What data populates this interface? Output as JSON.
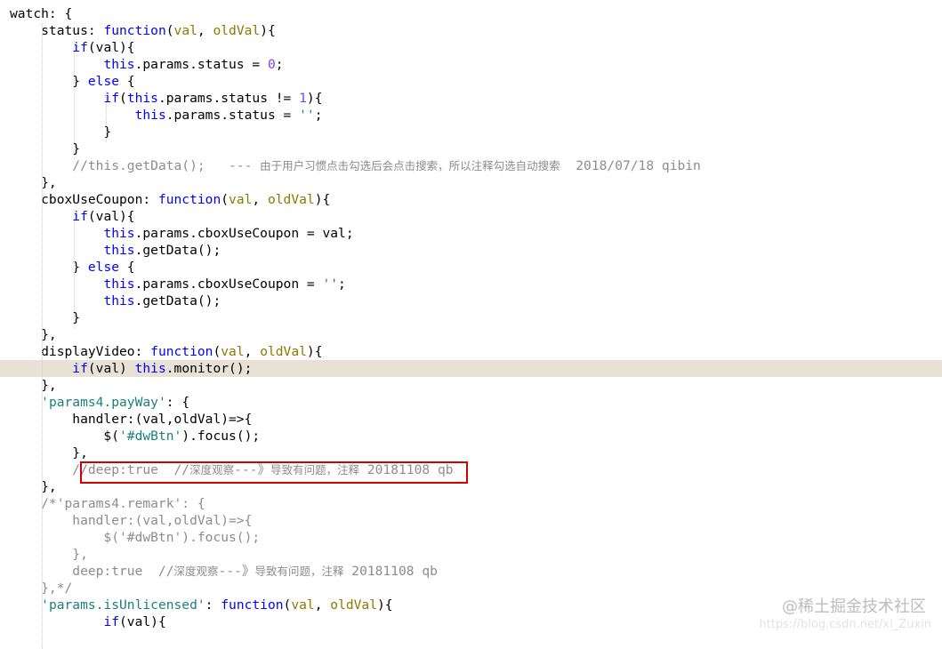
{
  "editor": {
    "lines": [
      {
        "tokens": [
          {
            "t": "watch: {",
            "c": ""
          }
        ]
      },
      {
        "tokens": [
          {
            "t": "    status: ",
            "c": ""
          },
          {
            "t": "function",
            "c": "k"
          },
          {
            "t": "(",
            "c": ""
          },
          {
            "t": "val",
            "c": "p"
          },
          {
            "t": ", ",
            "c": ""
          },
          {
            "t": "oldVal",
            "c": "p"
          },
          {
            "t": "){",
            "c": ""
          }
        ]
      },
      {
        "tokens": [
          {
            "t": "        ",
            "c": ""
          },
          {
            "t": "if",
            "c": "k"
          },
          {
            "t": "(val){",
            "c": ""
          }
        ]
      },
      {
        "tokens": [
          {
            "t": "            ",
            "c": ""
          },
          {
            "t": "this",
            "c": "k"
          },
          {
            "t": ".params.status = ",
            "c": ""
          },
          {
            "t": "0",
            "c": "n"
          },
          {
            "t": ";",
            "c": ""
          }
        ]
      },
      {
        "tokens": [
          {
            "t": "        } ",
            "c": ""
          },
          {
            "t": "else",
            "c": "k"
          },
          {
            "t": " {",
            "c": ""
          }
        ]
      },
      {
        "tokens": [
          {
            "t": "            ",
            "c": ""
          },
          {
            "t": "if",
            "c": "k"
          },
          {
            "t": "(",
            "c": ""
          },
          {
            "t": "this",
            "c": "k"
          },
          {
            "t": ".params.status != ",
            "c": ""
          },
          {
            "t": "1",
            "c": "n"
          },
          {
            "t": "){",
            "c": ""
          }
        ]
      },
      {
        "tokens": [
          {
            "t": "                ",
            "c": ""
          },
          {
            "t": "this",
            "c": "k"
          },
          {
            "t": ".params.status = ",
            "c": ""
          },
          {
            "t": "''",
            "c": "s"
          },
          {
            "t": ";",
            "c": ""
          }
        ]
      },
      {
        "tokens": [
          {
            "t": "            }",
            "c": ""
          }
        ]
      },
      {
        "tokens": [
          {
            "t": "        }",
            "c": ""
          }
        ]
      },
      {
        "tokens": [
          {
            "t": "        ",
            "c": ""
          },
          {
            "t": "//this.getData();   --- ",
            "c": "c"
          },
          {
            "t": "由于用户习惯点击勾选后会点击搜索，所以注释勾选自动搜索",
            "c": "cc"
          },
          {
            "t": "  2018/07/18 qibin",
            "c": "c"
          }
        ]
      },
      {
        "tokens": [
          {
            "t": "    },",
            "c": ""
          }
        ]
      },
      {
        "tokens": [
          {
            "t": "    cboxUseCoupon: ",
            "c": ""
          },
          {
            "t": "function",
            "c": "k"
          },
          {
            "t": "(",
            "c": ""
          },
          {
            "t": "val",
            "c": "p"
          },
          {
            "t": ", ",
            "c": ""
          },
          {
            "t": "oldVal",
            "c": "p"
          },
          {
            "t": "){",
            "c": ""
          }
        ]
      },
      {
        "tokens": [
          {
            "t": "        ",
            "c": ""
          },
          {
            "t": "if",
            "c": "k"
          },
          {
            "t": "(val){",
            "c": ""
          }
        ]
      },
      {
        "tokens": [
          {
            "t": "            ",
            "c": ""
          },
          {
            "t": "this",
            "c": "k"
          },
          {
            "t": ".params.cboxUseCoupon = val;",
            "c": ""
          }
        ]
      },
      {
        "tokens": [
          {
            "t": "            ",
            "c": ""
          },
          {
            "t": "this",
            "c": "k"
          },
          {
            "t": ".getData();",
            "c": ""
          }
        ]
      },
      {
        "tokens": [
          {
            "t": "        } ",
            "c": ""
          },
          {
            "t": "else",
            "c": "k"
          },
          {
            "t": " {",
            "c": ""
          }
        ]
      },
      {
        "tokens": [
          {
            "t": "            ",
            "c": ""
          },
          {
            "t": "this",
            "c": "k"
          },
          {
            "t": ".params.cboxUseCoupon = ",
            "c": ""
          },
          {
            "t": "''",
            "c": "s"
          },
          {
            "t": ";",
            "c": ""
          }
        ]
      },
      {
        "tokens": [
          {
            "t": "            ",
            "c": ""
          },
          {
            "t": "this",
            "c": "k"
          },
          {
            "t": ".getData();",
            "c": ""
          }
        ]
      },
      {
        "tokens": [
          {
            "t": "        }",
            "c": ""
          }
        ]
      },
      {
        "tokens": [
          {
            "t": "    },",
            "c": ""
          }
        ]
      },
      {
        "tokens": [
          {
            "t": "    displayVideo: ",
            "c": ""
          },
          {
            "t": "function",
            "c": "k"
          },
          {
            "t": "(",
            "c": ""
          },
          {
            "t": "val",
            "c": "p"
          },
          {
            "t": ", ",
            "c": ""
          },
          {
            "t": "oldVal",
            "c": "p"
          },
          {
            "t": "){",
            "c": ""
          }
        ]
      },
      {
        "current": true,
        "tokens": [
          {
            "t": "        ",
            "c": ""
          },
          {
            "t": "if",
            "c": "k"
          },
          {
            "t": "(val) ",
            "c": ""
          },
          {
            "t": "this",
            "c": "k"
          },
          {
            "t": ".monitor();",
            "c": ""
          }
        ]
      },
      {
        "tokens": [
          {
            "t": "    },",
            "c": ""
          }
        ]
      },
      {
        "tokens": [
          {
            "t": "    ",
            "c": ""
          },
          {
            "t": "'params4.payWay'",
            "c": "s"
          },
          {
            "t": ": {",
            "c": ""
          }
        ]
      },
      {
        "tokens": [
          {
            "t": "        handler:(val,oldVal)=>{",
            "c": ""
          }
        ]
      },
      {
        "tokens": [
          {
            "t": "            $(",
            "c": ""
          },
          {
            "t": "'#dwBtn'",
            "c": "s"
          },
          {
            "t": ").focus();",
            "c": ""
          }
        ]
      },
      {
        "tokens": [
          {
            "t": "        },",
            "c": ""
          }
        ]
      },
      {
        "tokens": [
          {
            "t": "        ",
            "c": ""
          },
          {
            "t": "//deep:true  //",
            "c": "c"
          },
          {
            "t": "深度观察",
            "c": "cc"
          },
          {
            "t": "---》",
            "c": "c"
          },
          {
            "t": "导致有问题，注释",
            "c": "cc"
          },
          {
            "t": " 20181108 qb",
            "c": "c"
          }
        ]
      },
      {
        "tokens": [
          {
            "t": "    },",
            "c": ""
          }
        ]
      },
      {
        "tokens": [
          {
            "t": "    /*'params4.remark': {",
            "c": "c"
          }
        ]
      },
      {
        "tokens": [
          {
            "t": "        handler:(val,oldVal)=>{",
            "c": "c"
          }
        ]
      },
      {
        "tokens": [
          {
            "t": "            $('#dwBtn').focus();",
            "c": "c"
          }
        ]
      },
      {
        "tokens": [
          {
            "t": "        },",
            "c": "c"
          }
        ]
      },
      {
        "tokens": [
          {
            "t": "        deep:true  //",
            "c": "c"
          },
          {
            "t": "深度观察",
            "c": "cc"
          },
          {
            "t": "---》",
            "c": "c"
          },
          {
            "t": "导致有问题，注释",
            "c": "cc"
          },
          {
            "t": " 20181108 qb",
            "c": "c"
          }
        ]
      },
      {
        "tokens": [
          {
            "t": "    },*/",
            "c": "c"
          }
        ]
      },
      {
        "tokens": [
          {
            "t": "    ",
            "c": ""
          },
          {
            "t": "'params.isUnlicensed'",
            "c": "s"
          },
          {
            "t": ": ",
            "c": ""
          },
          {
            "t": "function",
            "c": "k"
          },
          {
            "t": "(",
            "c": ""
          },
          {
            "t": "val",
            "c": "p"
          },
          {
            "t": ", ",
            "c": ""
          },
          {
            "t": "oldVal",
            "c": "p"
          },
          {
            "t": "){",
            "c": ""
          }
        ]
      },
      {
        "tokens": [
          {
            "t": "            ",
            "c": ""
          },
          {
            "t": "if",
            "c": "k"
          },
          {
            "t": "(val){",
            "c": ""
          }
        ]
      }
    ]
  },
  "watermark": {
    "link": "https://blog.csdn.net/xi_Zuxin",
    "brand": "@稀土掘金技术社区"
  }
}
